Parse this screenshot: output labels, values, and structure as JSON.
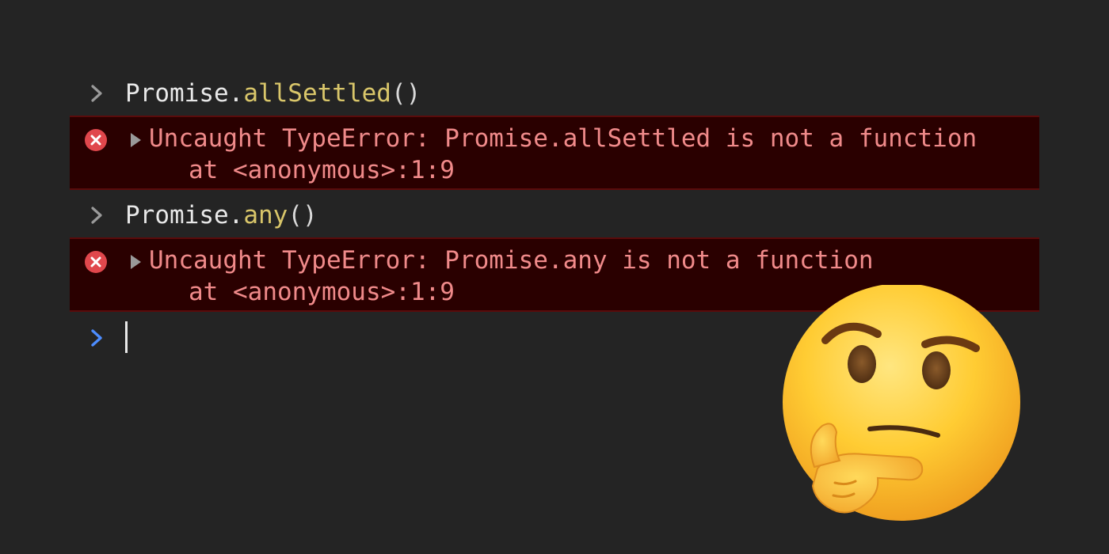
{
  "console": {
    "entries": [
      {
        "input": {
          "object": "Promise.",
          "method": "allSettled",
          "parens": "()"
        },
        "error": {
          "message": "Uncaught TypeError: Promise.allSettled is not a function",
          "trace": "at <anonymous>:1:9"
        }
      },
      {
        "input": {
          "object": "Promise.",
          "method": "any",
          "parens": "()"
        },
        "error": {
          "message": "Uncaught TypeError: Promise.any is not a function",
          "trace": "at <anonymous>:1:9"
        }
      }
    ],
    "prompt_value": ""
  },
  "icons": {
    "prompt": "chevron-right-icon",
    "error": "error-circle-x-icon",
    "expand": "triangle-right-icon",
    "emoji": "thinking-face-emoji"
  },
  "colors": {
    "background": "#242424",
    "error_background": "#2a0000",
    "error_border": "#5a0b0b",
    "error_text": "#f08a8a",
    "method_text": "#d9c66a",
    "active_prompt": "#4d8dff"
  }
}
